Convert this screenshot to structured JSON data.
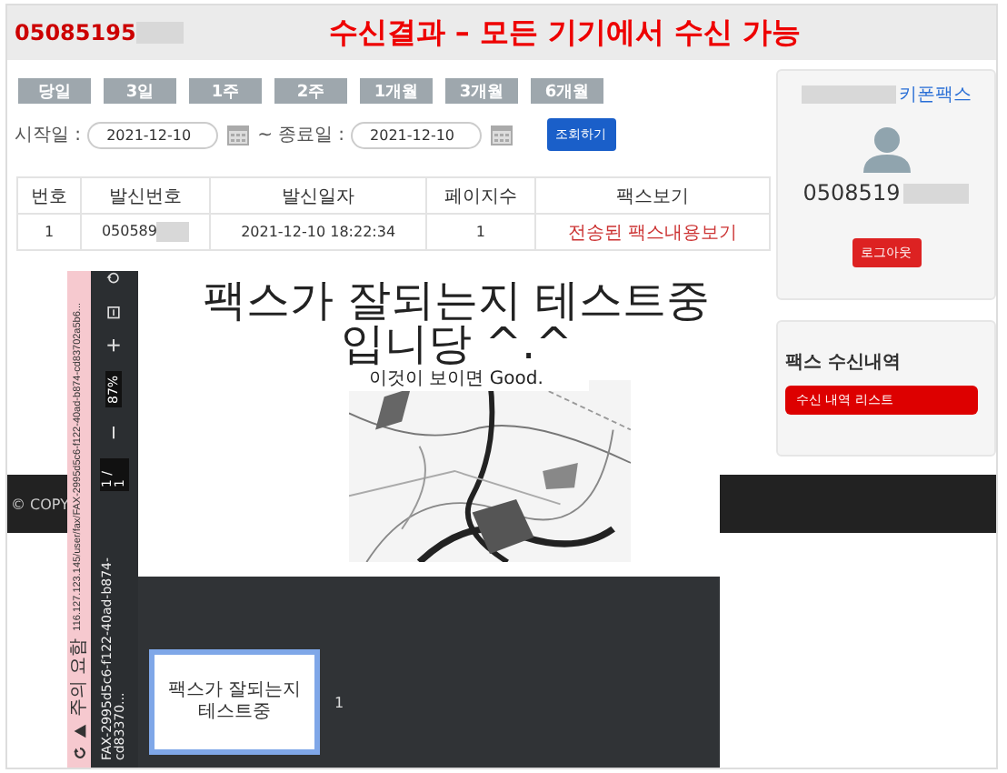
{
  "header": {
    "number": "05085195",
    "title": "수신결과 – 모든 기기에서 수신 가능"
  },
  "period_buttons": [
    "당일",
    "3일",
    "1주",
    "2주",
    "1개월",
    "3개월",
    "6개월"
  ],
  "date_filter": {
    "start_label": "시작일 :",
    "start_value": "2021-12-10",
    "separator": "~",
    "end_label": "종료일 :",
    "end_value": "2021-12-10",
    "search_button": "조회하기"
  },
  "table": {
    "columns": [
      "번호",
      "발신번호",
      "발신일자",
      "페이지수",
      "팩스보기"
    ],
    "rows": [
      {
        "cells": [
          "1",
          "050589",
          "2021-12-10 18:22:34",
          "1"
        ],
        "link": "전송된 팩스내용보기"
      }
    ]
  },
  "profile": {
    "name": "키폰팩스",
    "number": "0508519",
    "logout": "로그아웃"
  },
  "fax_menu": {
    "title": "팩스 수신내역",
    "button": "수신 내역 리스트"
  },
  "footer": {
    "copyright": "© COPY"
  },
  "viewer": {
    "warning": "주의 요함",
    "url": "116.127.123.145/user/fax/FAX-2995d5c6-f122-40ad-b874-cd83702a5b6...",
    "file_name": "FAX-2995d5c6-f122-40ad-b874-cd83370...",
    "zoom": "87%",
    "page": "1 / 1",
    "page_title": "팩스가 잘되는지 테스트중 입니당 ^.^",
    "page_note": "이것이 보이면 Good.",
    "thumbnails": [
      {
        "text": "팩스가 잘되는지 테스트중",
        "number": "1",
        "selected": true
      }
    ]
  }
}
